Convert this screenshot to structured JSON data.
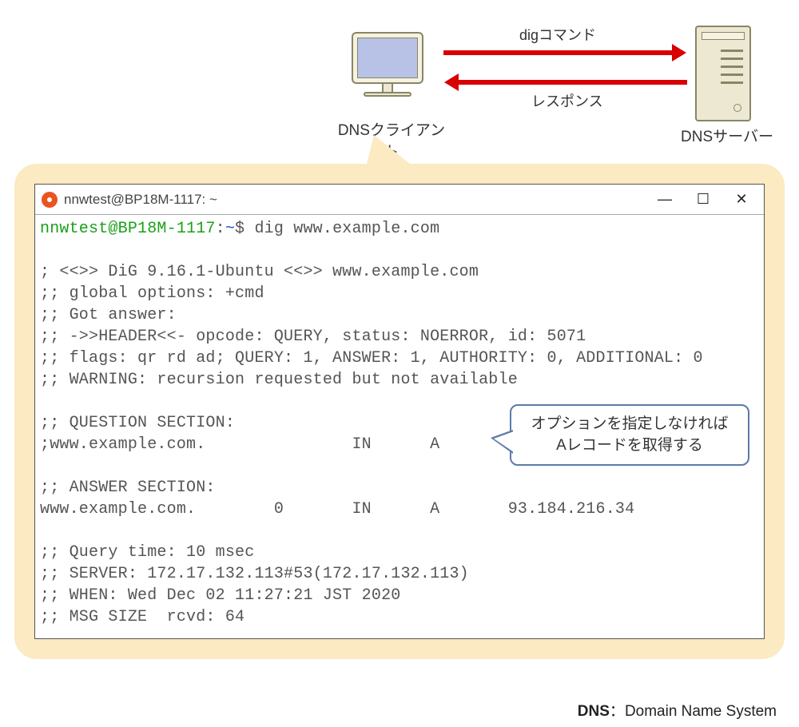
{
  "diagram": {
    "client_label": "DNSクライアント",
    "server_label": "DNSサーバー",
    "arrow_to_server_label": "digコマンド",
    "arrow_to_client_label": "レスポンス"
  },
  "terminal": {
    "window_title": "nnwtest@BP18M-1117: ~",
    "prompt_user_host": "nnwtest@BP18M-1117",
    "prompt_path": "~",
    "prompt_symbol": "$",
    "command": "dig www.example.com",
    "output_lines": [
      "",
      "; <<>> DiG 9.16.1-Ubuntu <<>> www.example.com",
      ";; global options: +cmd",
      ";; Got answer:",
      ";; ->>HEADER<<- opcode: QUERY, status: NOERROR, id: 5071",
      ";; flags: qr rd ad; QUERY: 1, ANSWER: 1, AUTHORITY: 0, ADDITIONAL: 0",
      ";; WARNING: recursion requested but not available",
      "",
      ";; QUESTION SECTION:",
      ";www.example.com.               IN      A",
      "",
      ";; ANSWER SECTION:",
      "www.example.com.        0       IN      A       93.184.216.34",
      "",
      ";; Query time: 10 msec",
      ";; SERVER: 172.17.132.113#53(172.17.132.113)",
      ";; WHEN: Wed Dec 02 11:27:21 JST 2020",
      ";; MSG SIZE  rcvd: 64"
    ]
  },
  "annotation": {
    "line1": "オプションを指定しなければ",
    "line2": "Aレコードを取得する"
  },
  "footer": {
    "term": "DNS",
    "sep": "：",
    "expansion": "Domain Name System"
  },
  "win_controls": {
    "minimize": "—",
    "maximize": "☐",
    "close": "✕"
  }
}
